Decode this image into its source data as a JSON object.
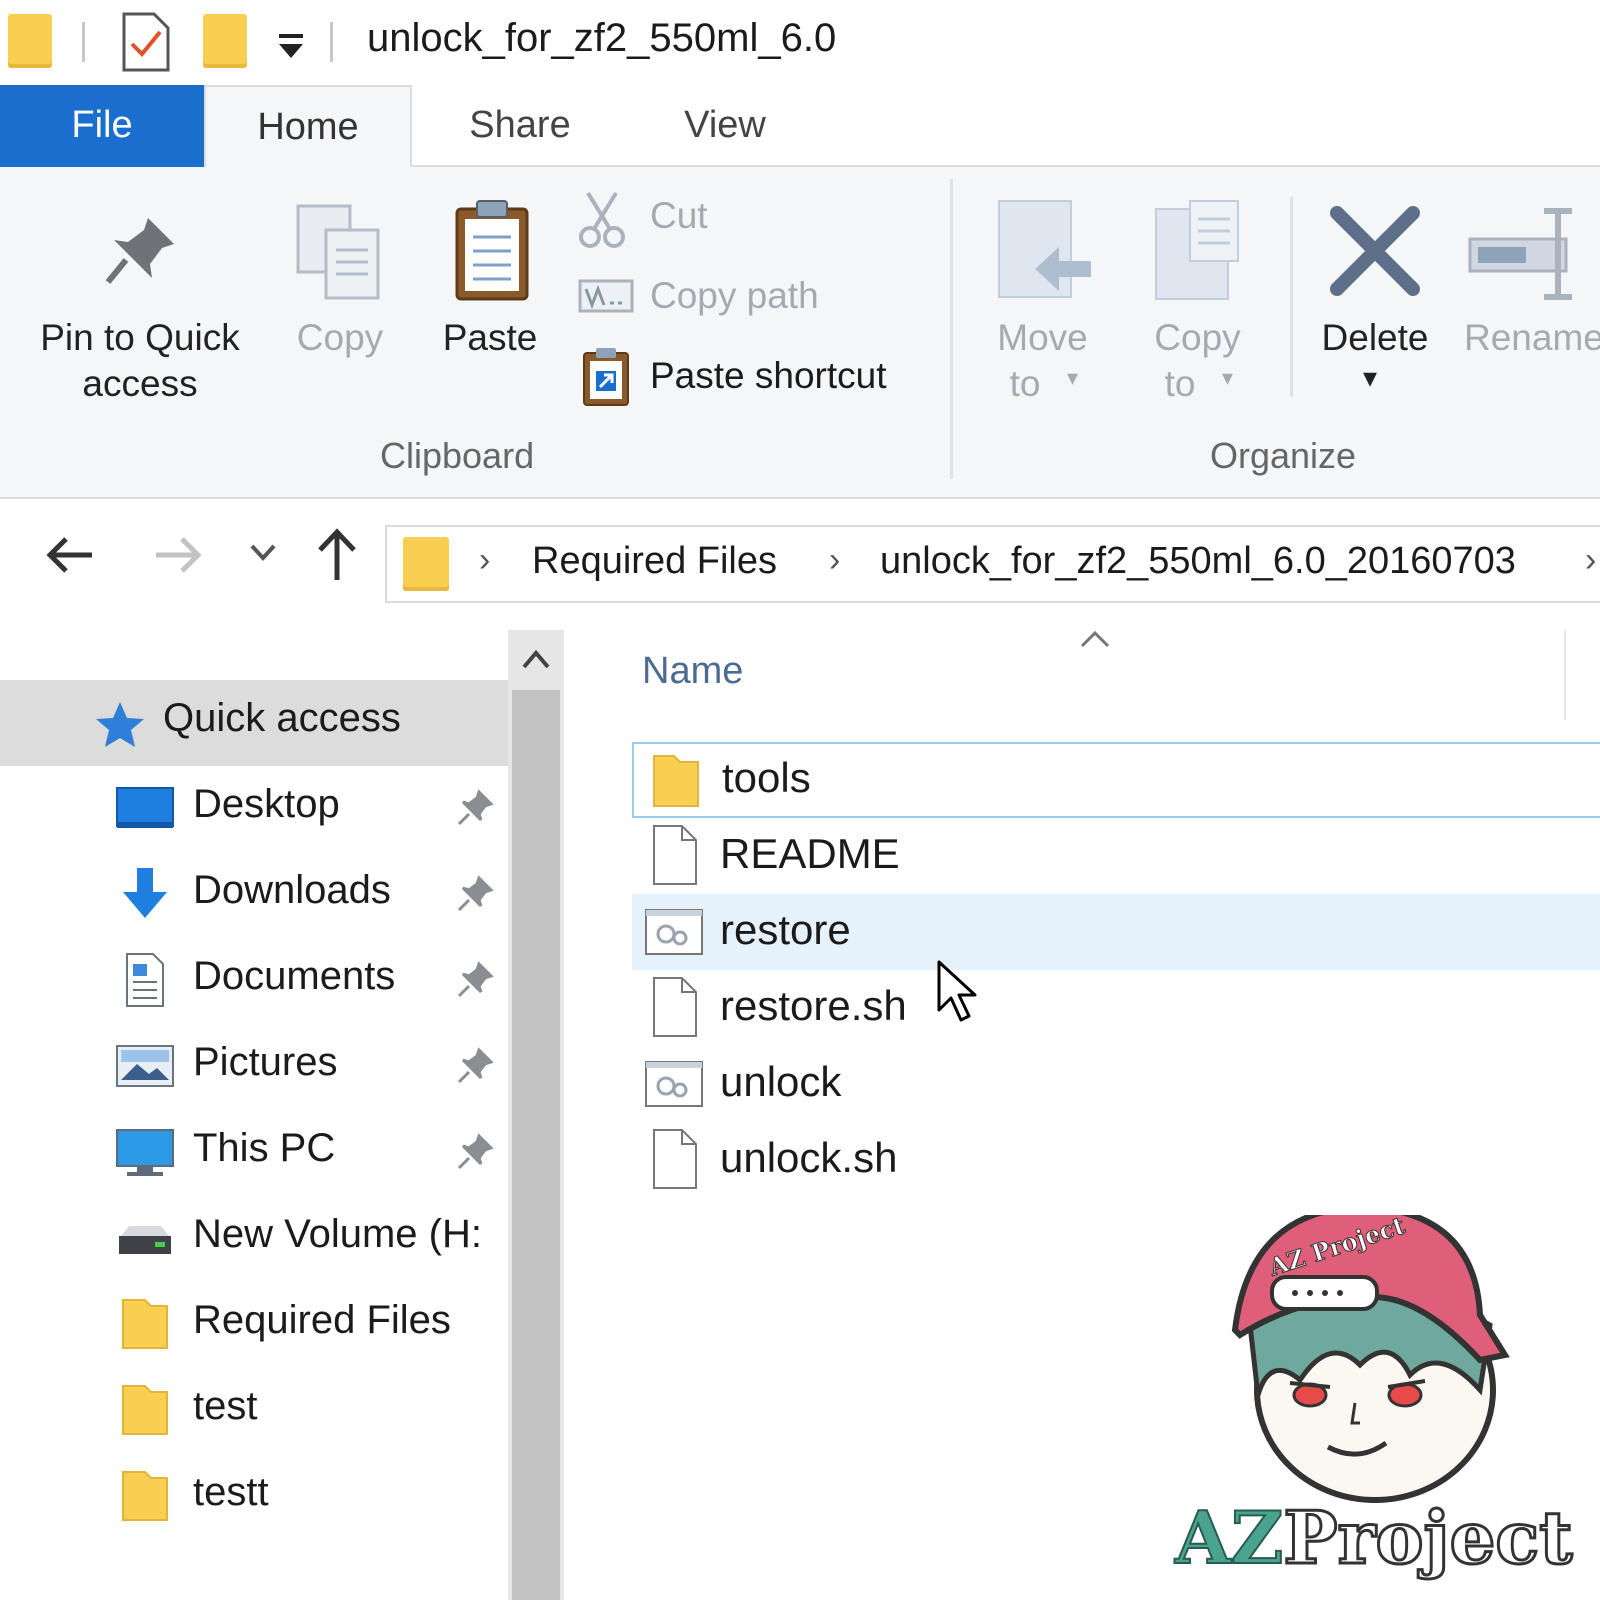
{
  "window": {
    "title": "unlock_for_zf2_550ml_6.0"
  },
  "tabs": {
    "file": "File",
    "home": "Home",
    "share": "Share",
    "view": "View"
  },
  "ribbon": {
    "pin_line1": "Pin to Quick",
    "pin_line2": "access",
    "copy": "Copy",
    "paste": "Paste",
    "cut": "Cut",
    "copy_path": "Copy path",
    "paste_shortcut": "Paste shortcut",
    "clipboard_group": "Clipboard",
    "move_line1": "Move",
    "move_line2": "to",
    "copyto_line1": "Copy",
    "copyto_line2": "to",
    "delete": "Delete",
    "rename": "Rename",
    "organize_group": "Organize"
  },
  "address": {
    "crumbs": [
      "Required Files",
      "unlock_for_zf2_550ml_6.0_20160703"
    ]
  },
  "sidebar": {
    "items": [
      {
        "label": "Quick access",
        "icon": "star-icon"
      },
      {
        "label": "Desktop",
        "icon": "desktop-icon",
        "pinned": true
      },
      {
        "label": "Downloads",
        "icon": "download-icon",
        "pinned": true
      },
      {
        "label": "Documents",
        "icon": "documents-icon",
        "pinned": true
      },
      {
        "label": "Pictures",
        "icon": "pictures-icon",
        "pinned": true
      },
      {
        "label": "This PC",
        "icon": "computer-icon",
        "pinned": true
      },
      {
        "label": "New Volume (H:",
        "icon": "drive-icon"
      },
      {
        "label": "Required Files",
        "icon": "folder-icon"
      },
      {
        "label": "test",
        "icon": "folder-icon"
      },
      {
        "label": "testt",
        "icon": "folder-icon"
      }
    ]
  },
  "filelist": {
    "column_name": "Name",
    "files": [
      {
        "name": "tools",
        "type": "folder"
      },
      {
        "name": "README",
        "type": "file"
      },
      {
        "name": "restore",
        "type": "executable"
      },
      {
        "name": "restore.sh",
        "type": "file"
      },
      {
        "name": "unlock",
        "type": "executable"
      },
      {
        "name": "unlock.sh",
        "type": "file"
      }
    ]
  },
  "logo": {
    "badge": "AZ Project",
    "text_az": "AZ",
    "text_project": "Project"
  },
  "colors": {
    "accent": "#1a6fce",
    "folder": "#f8cf51",
    "selection": "#e5f1fb",
    "focus_border": "#99c9ef"
  }
}
